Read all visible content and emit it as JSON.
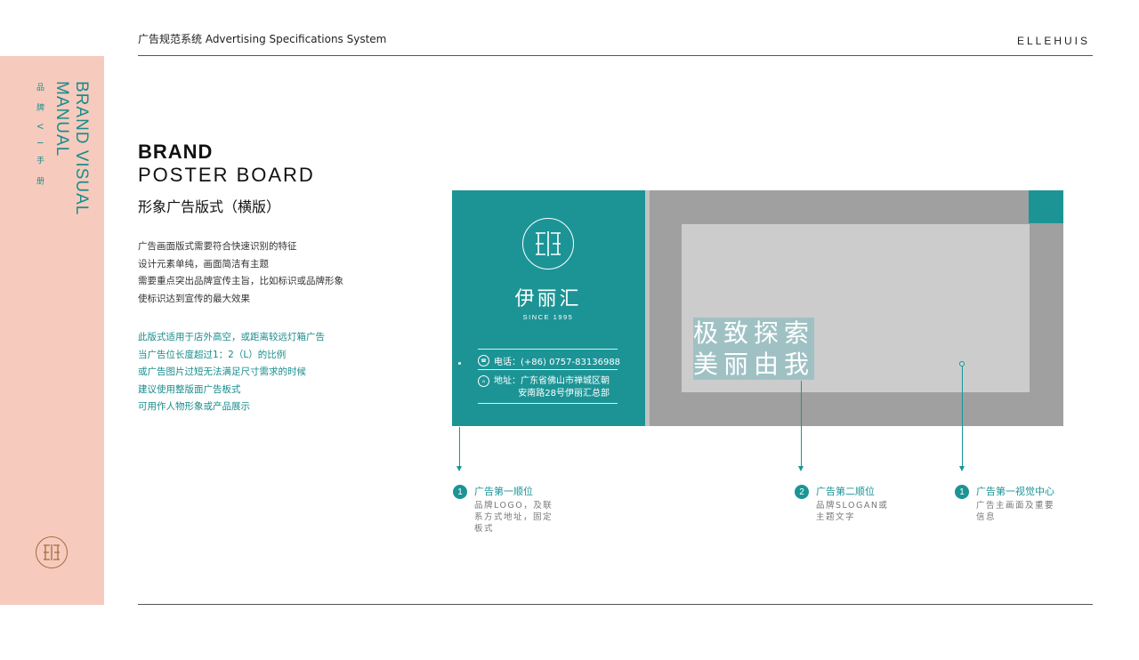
{
  "header": {
    "title": "广告规范系统  Advertising Specifications System",
    "brand": "ELLEHUIS"
  },
  "sidebar": {
    "title_line1": "BRAND VISUAL",
    "title_line2": "MANUAL",
    "subtitle": "品牌VI手册",
    "logo_icon": "ellehuis-monogram-icon"
  },
  "section": {
    "title_bold": "BRAND",
    "title_light": "POSTER  BOARD",
    "title_cn": "形象广告版式（横版）"
  },
  "description": {
    "dark_lines": [
      "广告画面版式需要符合快速识别的特征",
      "设计元素单纯，画面简洁有主题",
      "需要重点突出品牌宣传主旨，比如标识或品牌形象",
      "使标识达到宣传的最大效果"
    ],
    "teal_lines": [
      "此版式适用于店外高空，或距离较远灯箱广告",
      "当广告位长度超过1：2（L）的比例",
      "或广告图片过短无法满足尺寸需求的时候",
      "建议使用整版面广告板式",
      "可用作人物形象或产品展示"
    ]
  },
  "poster": {
    "logo_name": "伊丽汇",
    "since": "SINCE 1995",
    "phone": "电话：(+86) 0757-83136988",
    "address_line1": "地址：广东省佛山市禅城区朝",
    "address_line2": "安南路28号伊丽汇总部",
    "slogan_line1": "极致探索",
    "slogan_line2": "美丽由我",
    "colors": {
      "teal": "#1c9496",
      "gray": "#a0a0a0",
      "inner": "#cccccc",
      "slogan_bg": "#9fc1c4"
    }
  },
  "callouts": [
    {
      "num": "1",
      "title": "广告第一顺位",
      "desc": [
        "品牌LOGO，及联",
        "系方式地址，固定",
        "板式"
      ]
    },
    {
      "num": "2",
      "title": "广告第二顺位",
      "desc": [
        "品牌SLOGAN或",
        "主题文字"
      ]
    },
    {
      "num": "1",
      "title": "广告第一视觉中心",
      "desc": [
        "广告主画面及重要",
        "信息"
      ]
    }
  ]
}
